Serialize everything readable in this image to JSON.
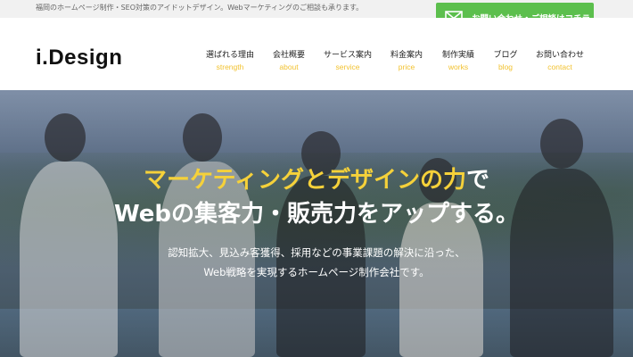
{
  "topbar": {
    "tagline": "福岡のホームページ制作・SEO対策のアイドットデザイン。Webマーケティングのご相談も承ります。"
  },
  "contact_button": {
    "label": "お問い合わせ・ご相談はコチラ",
    "icon": "mail-icon"
  },
  "header": {
    "logo": "i.Design"
  },
  "nav": [
    {
      "jp": "選ばれる理由",
      "en": "strength"
    },
    {
      "jp": "会社概要",
      "en": "about"
    },
    {
      "jp": "サービス案内",
      "en": "service"
    },
    {
      "jp": "料金案内",
      "en": "price"
    },
    {
      "jp": "制作実績",
      "en": "works"
    },
    {
      "jp": "ブログ",
      "en": "blog"
    },
    {
      "jp": "お問い合わせ",
      "en": "contact"
    }
  ],
  "hero": {
    "headline_highlight": "マーケティングとデザインの力",
    "headline_tail": "で",
    "headline_line2": "Webの集客力・販売力をアップする。",
    "desc_line1": "認知拡大、見込み客獲得、採用などの事業課題の解決に沿った、",
    "desc_line2": "Web戦略を実現するホームページ制作会社です。"
  },
  "colors": {
    "accent_green": "#5cbf4d",
    "accent_yellow": "#f2c230",
    "headline_yellow": "#f5d13a"
  }
}
